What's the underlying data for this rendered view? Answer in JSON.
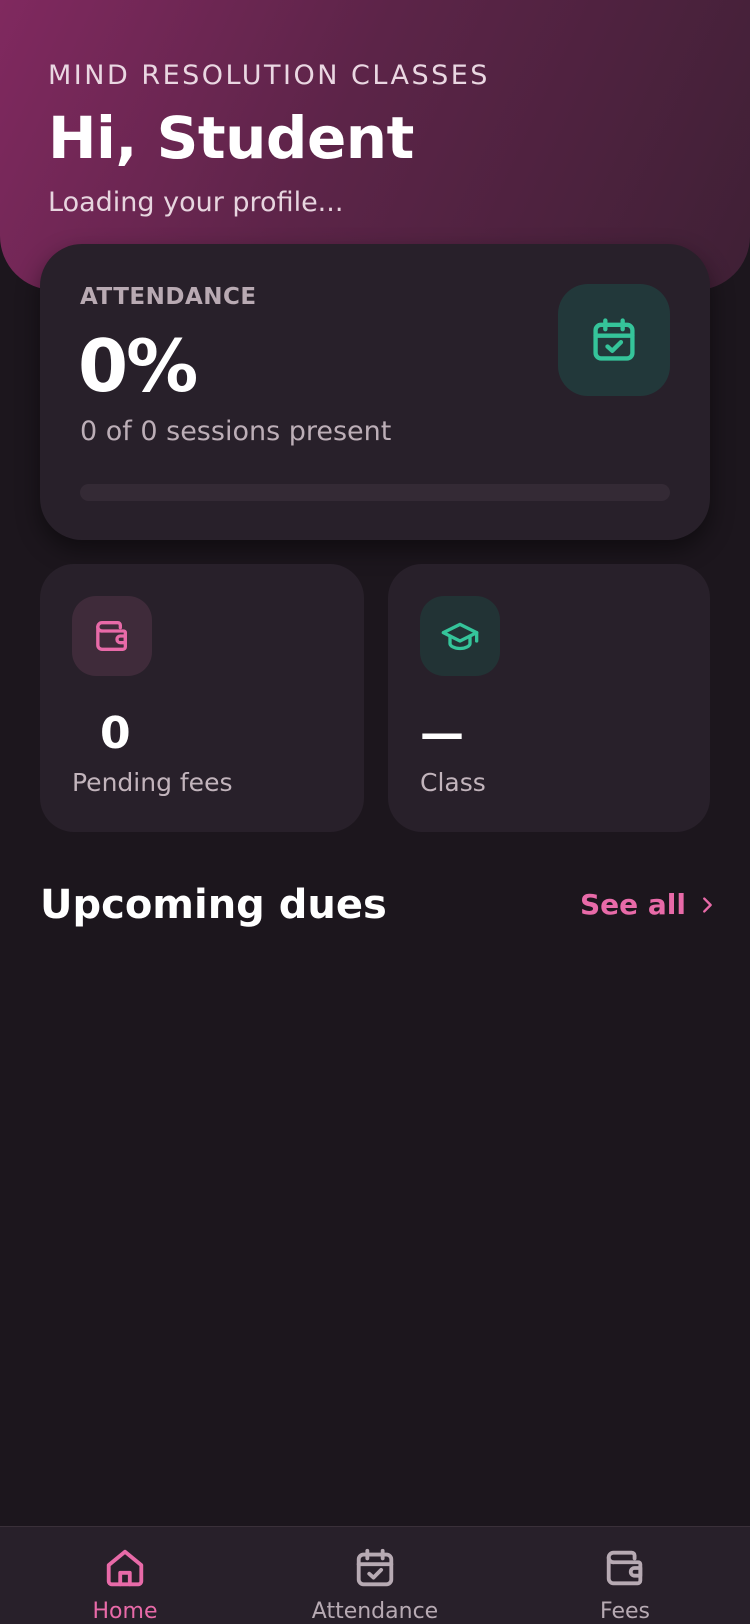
{
  "header": {
    "brand": "MIND RESOLUTION CLASSES",
    "greeting": "Hi, Student",
    "subtitle": "Loading your profile..."
  },
  "attendance": {
    "label": "ATTENDANCE",
    "value": "0%",
    "summary": "0 of 0 sessions present",
    "progress_percent": 0,
    "icon": "calendar-check-icon"
  },
  "stats": {
    "fees": {
      "value": "0",
      "label": "Pending fees",
      "icon": "wallet-icon"
    },
    "class": {
      "value": "—",
      "label": "Class",
      "icon": "graduation-cap-icon"
    }
  },
  "upcoming": {
    "title": "Upcoming dues",
    "see_all": "See all"
  },
  "nav": {
    "items": [
      {
        "label": "Home",
        "icon": "home-icon",
        "active": true
      },
      {
        "label": "Attendance",
        "icon": "calendar-check-icon",
        "active": false
      },
      {
        "label": "Fees",
        "icon": "wallet-icon",
        "active": false
      }
    ]
  },
  "colors": {
    "background": "#1c161d",
    "card": "#28202a",
    "accent_pink": "#e86aa8",
    "accent_green": "#35c49a",
    "hero_start": "#80295f",
    "hero_end": "#3f2035"
  }
}
